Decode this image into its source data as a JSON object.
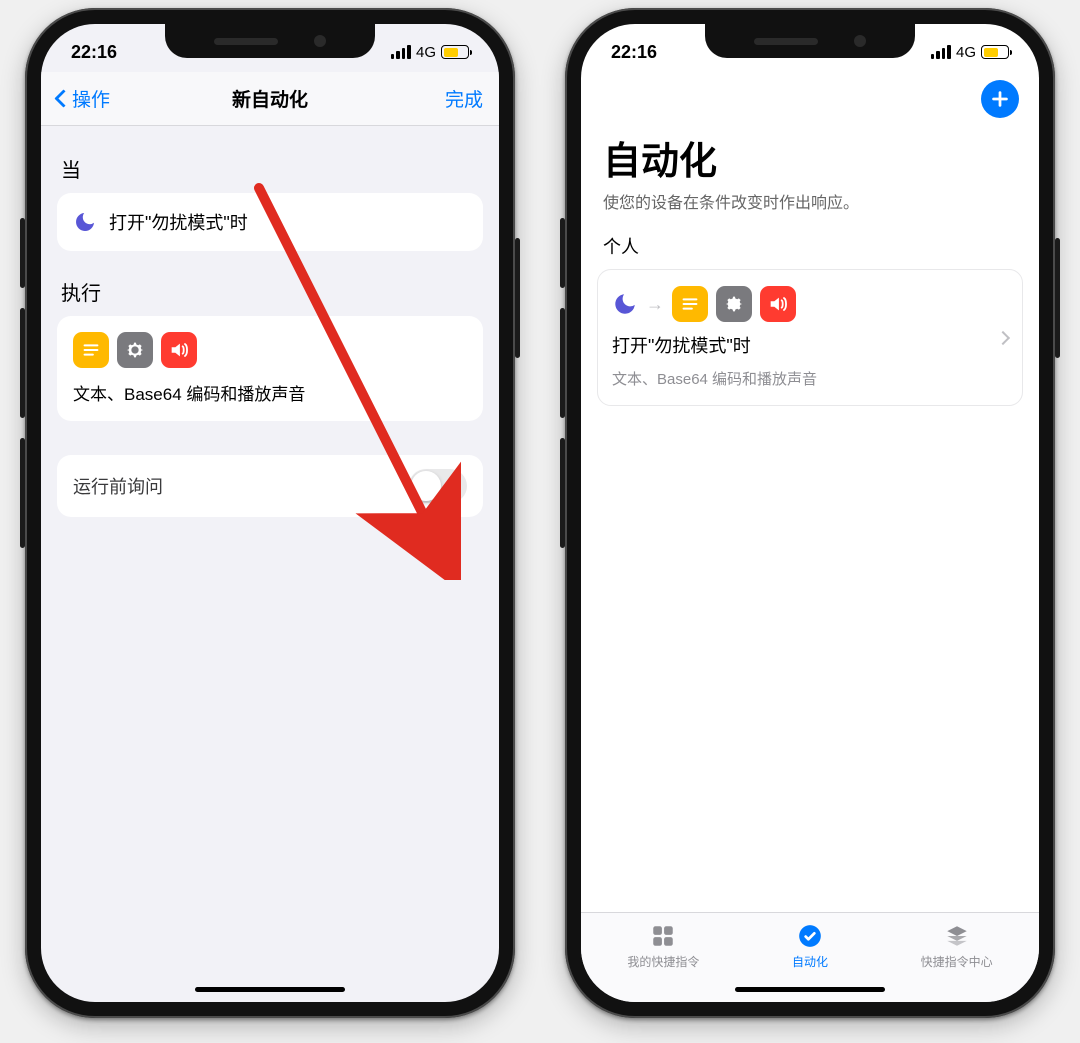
{
  "status": {
    "time": "22:16",
    "network": "4G"
  },
  "left": {
    "nav": {
      "back": "操作",
      "title": "新自动化",
      "done": "完成"
    },
    "when_label": "当",
    "condition": "打开\"勿扰模式\"时",
    "do_label": "执行",
    "exec_desc": "文本、Base64 编码和播放声音",
    "ask_label": "运行前询问"
  },
  "right": {
    "title": "自动化",
    "subtitle": "使您的设备在条件改变时作出响应。",
    "group": "个人",
    "item": {
      "title": "打开\"勿扰模式\"时",
      "subtitle": "文本、Base64 编码和播放声音"
    },
    "tabs": {
      "mine": "我的快捷指令",
      "auto": "自动化",
      "center": "快捷指令中心"
    }
  }
}
